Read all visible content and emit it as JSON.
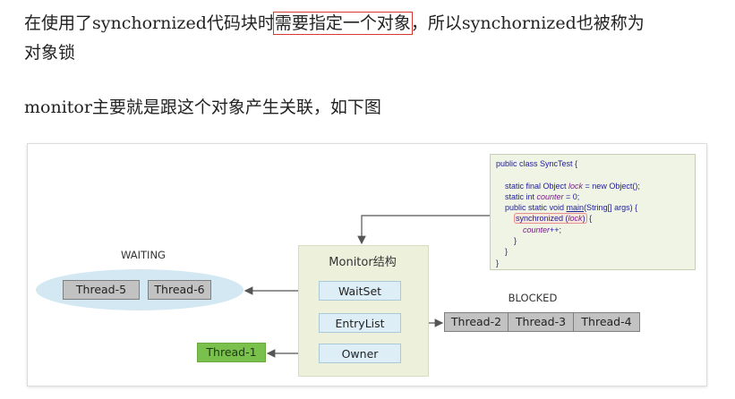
{
  "text": {
    "line1_before": "在使用了synchornized代码块时",
    "line1_highlight": "需要指定一个对象",
    "line1_after": "，所以synchornized也被称为",
    "line2": "对象锁",
    "line3": "monitor主要就是跟这个对象产生关联，如下图"
  },
  "diagram": {
    "monitor_title": "Monitor结构",
    "waitset": "WaitSet",
    "entrylist": "EntryList",
    "owner": "Owner",
    "waiting_label": "WAITING",
    "blocked_label": "BLOCKED",
    "waiting_threads": [
      "Thread-5",
      "Thread-6"
    ],
    "blocked_threads": [
      "Thread-2",
      "Thread-3",
      "Thread-4"
    ],
    "owner_thread": "Thread-1"
  },
  "code": {
    "l1": "public class SyncTest {",
    "l2_pre": "    static final Object ",
    "l2_var": "lock",
    "l2_post": " = new Object();",
    "l3_pre": "    static int ",
    "l3_var": "counter",
    "l3_post": " = 0;",
    "l4_pre": "    public static void ",
    "l4_fn": "main",
    "l4_post": "(String[] args) {",
    "l5_pre": "        ",
    "l5_sync": "synchronized (",
    "l5_var": "lock",
    "l5_sync_end": ")",
    "l5_post": " {",
    "l6_pre": "            ",
    "l6_var": "counter",
    "l6_post": "++;",
    "l7": "        }",
    "l8": "    }",
    "l9": "}"
  },
  "colors": {
    "highlight_border": "#d93636",
    "monitor_bg": "#edf1dc",
    "waiting_bg": "#d3e8f3",
    "owner_green": "#7ac04c",
    "blocked_gray": "#c2c2c2"
  }
}
